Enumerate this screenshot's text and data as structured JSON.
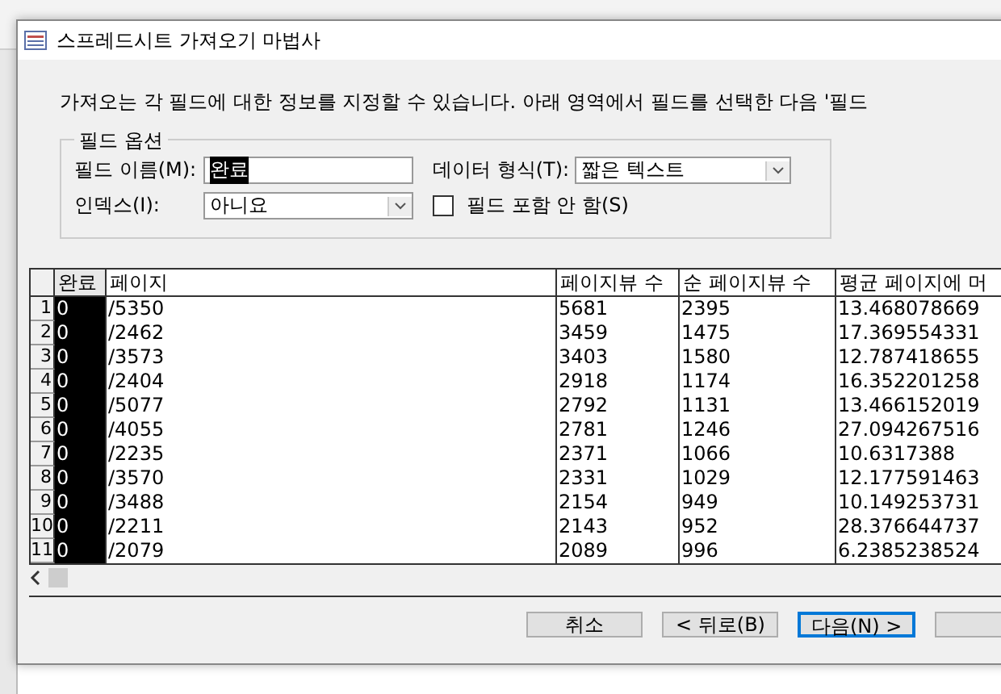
{
  "window": {
    "title": "스프레드시트 가져오기 마법사"
  },
  "instructions": "가져오는 각 필드에 대한 정보를 지정할 수 있습니다. 아래 영역에서 필드를 선택한 다음 '필드",
  "field_options": {
    "title": "필드 옵션",
    "field_name": {
      "label": "필드 이름(M):",
      "value": "완료"
    },
    "data_type": {
      "label": "데이터 형식(T):",
      "value": "짧은 텍스트"
    },
    "index": {
      "label": "인덱스(I):",
      "value": "아니요"
    },
    "skip_field": {
      "label": "필드 포함 안 함(S)",
      "checked": false
    }
  },
  "table": {
    "columns": [
      {
        "label": "완료",
        "selected": true
      },
      {
        "label": "페이지",
        "selected": false
      },
      {
        "label": "페이지뷰 수",
        "selected": false
      },
      {
        "label": "순 페이지뷰 수",
        "selected": false
      },
      {
        "label": "평균 페이지에 머",
        "selected": false
      }
    ],
    "rows": [
      {
        "number": "1",
        "cells": [
          "0",
          "/5350",
          "5681",
          "2395",
          "13.468078669"
        ]
      },
      {
        "number": "2",
        "cells": [
          "0",
          "/2462",
          "3459",
          "1475",
          "17.369554331"
        ]
      },
      {
        "number": "3",
        "cells": [
          "0",
          "/3573",
          "3403",
          "1580",
          "12.787418655"
        ]
      },
      {
        "number": "4",
        "cells": [
          "0",
          "/2404",
          "2918",
          "1174",
          "16.352201258"
        ]
      },
      {
        "number": "5",
        "cells": [
          "0",
          "/5077",
          "2792",
          "1131",
          "13.466152019"
        ]
      },
      {
        "number": "6",
        "cells": [
          "0",
          "/4055",
          "2781",
          "1246",
          "27.094267516"
        ]
      },
      {
        "number": "7",
        "cells": [
          "0",
          "/2235",
          "2371",
          "1066",
          "10.6317388"
        ]
      },
      {
        "number": "8",
        "cells": [
          "0",
          "/3570",
          "2331",
          "1029",
          "12.177591463"
        ]
      },
      {
        "number": "9",
        "cells": [
          "0",
          "/3488",
          "2154",
          "949",
          "10.149253731"
        ]
      },
      {
        "number": "10",
        "cells": [
          "0",
          "/2211",
          "2143",
          "952",
          "28.376644737"
        ]
      },
      {
        "number": "11",
        "cells": [
          "0",
          "/2079",
          "2089",
          "996",
          "6.2385238524"
        ]
      }
    ]
  },
  "buttons": [
    {
      "label": "취소",
      "default": false
    },
    {
      "label": "< 뒤로(B)",
      "default": false
    },
    {
      "label": "다음(N) >",
      "default": true
    }
  ]
}
